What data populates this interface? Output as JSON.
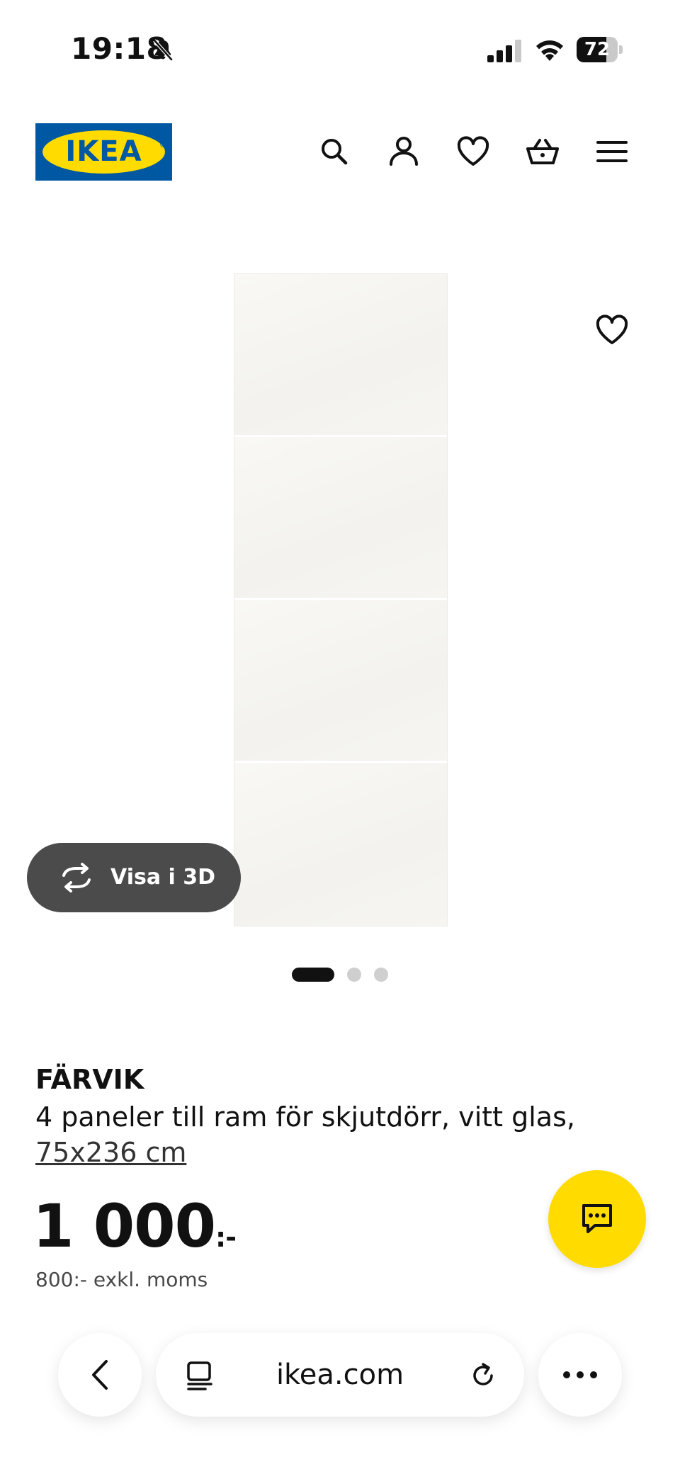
{
  "status_bar": {
    "time": "19:18",
    "battery_percent": 72,
    "battery_label": "72",
    "icons": [
      "bell-slash-icon",
      "signal-icon",
      "wifi-icon",
      "battery-icon"
    ]
  },
  "header": {
    "logo_text": "IKEA",
    "logo_colors": {
      "background": "#0058a3",
      "oval": "#ffdb00"
    },
    "icons": [
      "search-icon",
      "user-icon",
      "heart-icon",
      "basket-icon",
      "menu-icon"
    ]
  },
  "gallery": {
    "view_3d_label": "Visa i 3D",
    "image_count": 3,
    "active_index": 0
  },
  "product": {
    "name": "FÄRVIK",
    "description": "4 paneler till ram för skjutdörr, vitt glas,",
    "size": "75x236 cm",
    "price_main": "1 000",
    "price_suffix": ":-",
    "price_excl_vat": "800:- exkl. moms"
  },
  "chat": {
    "icon": "chat-icon",
    "color": "#ffdb00"
  },
  "browser": {
    "url": "ikea.com",
    "icons": [
      "back-icon",
      "reader-icon",
      "reload-icon",
      "more-icon"
    ]
  }
}
